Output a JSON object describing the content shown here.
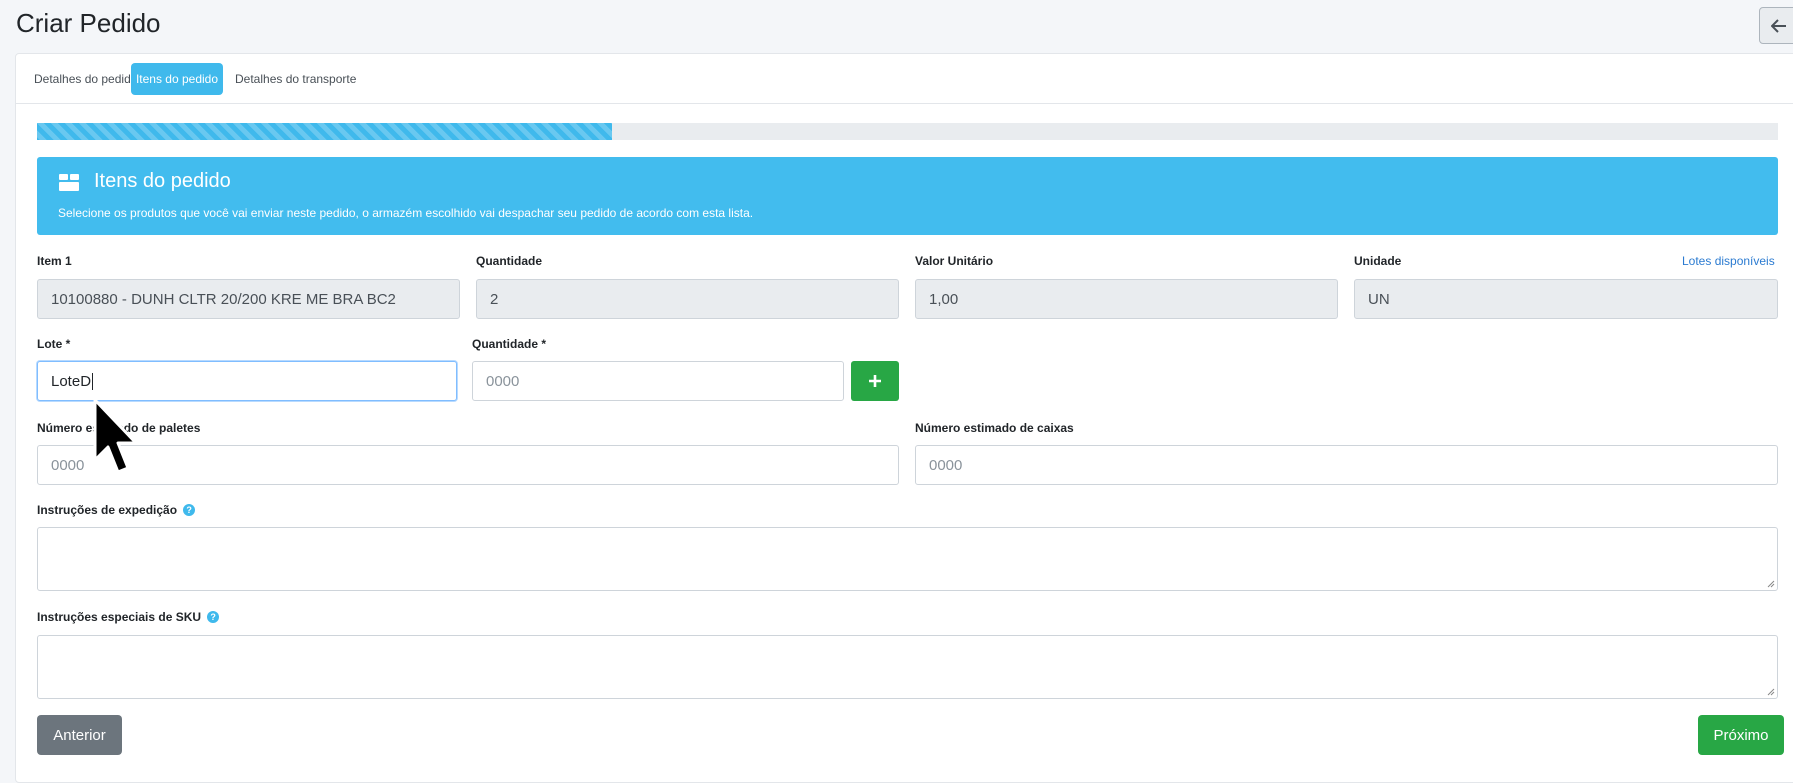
{
  "page": {
    "title": "Criar Pedido"
  },
  "tabs": [
    {
      "label": "Detalhes do pedido",
      "active": false
    },
    {
      "label": "Itens do pedido",
      "active": true
    },
    {
      "label": "Detalhes do transporte",
      "active": false
    }
  ],
  "progress": {
    "percent": 33
  },
  "banner": {
    "icon": "box-icon",
    "title": "Itens do pedido",
    "text": "Selecione os produtos que você vai enviar neste pedido, o armazém escolhido vai despachar seu pedido de acordo com esta lista."
  },
  "item": {
    "item_label": "Item 1",
    "item_value": "10100880 - DUNH CLTR 20/200 KRE ME BRA BC2",
    "qty_label": "Quantidade",
    "qty_value": "2",
    "unit_value_label": "Valor Unitário",
    "unit_value": "1,00",
    "unit_label": "Unidade",
    "unit": "UN",
    "lots_link": "Lotes disponíveis"
  },
  "lot": {
    "lot_label": "Lote *",
    "lot_value": "LoteD",
    "qty_label": "Quantidade *",
    "qty_placeholder": "0000"
  },
  "estimates": {
    "pallets_label": "Número estimado de paletes",
    "pallets_placeholder": "0000",
    "boxes_label": "Número estimado de caixas",
    "boxes_placeholder": "0000"
  },
  "instructions": {
    "shipping_label": "Instruções de expedição",
    "sku_label": "Instruções especiais de SKU"
  },
  "footer": {
    "prev_label": "Anterior",
    "next_label": "Próximo"
  },
  "colors": {
    "accent": "#42bcee",
    "success": "#28a745",
    "secondary": "#6c757d"
  }
}
